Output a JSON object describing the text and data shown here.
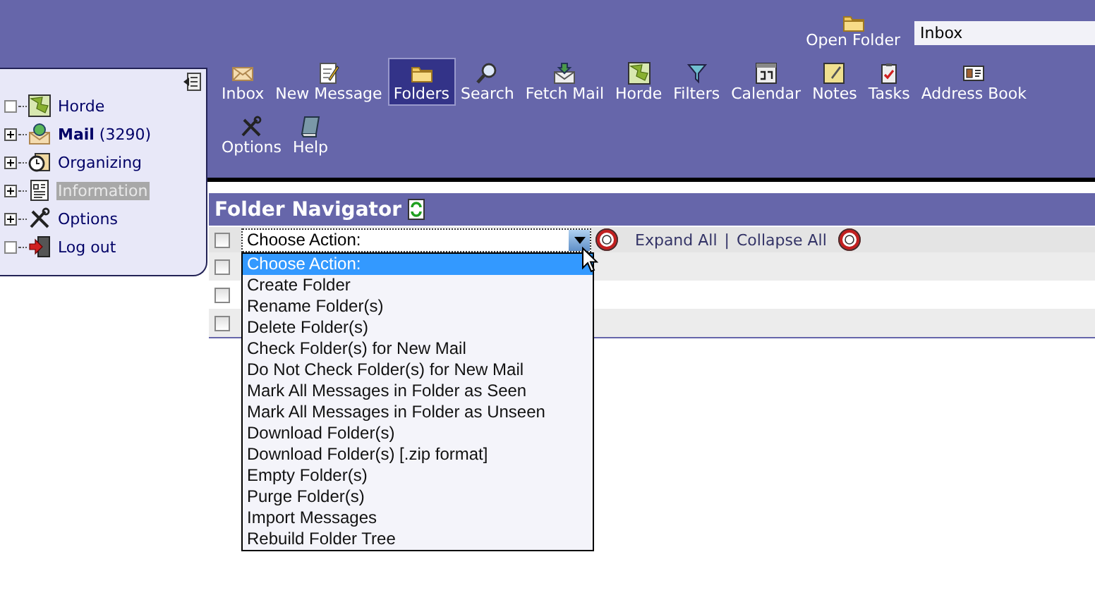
{
  "open_folder": {
    "label": "Open Folder",
    "value": "Inbox"
  },
  "toolbar": {
    "rows": [
      [
        {
          "label": "Inbox",
          "selected": false
        },
        {
          "label": "New Message",
          "selected": false
        },
        {
          "label": "Folders",
          "selected": true
        },
        {
          "label": "Search",
          "selected": false
        },
        {
          "label": "Fetch Mail",
          "selected": false
        },
        {
          "label": "Horde",
          "selected": false
        },
        {
          "label": "Filters",
          "selected": false
        },
        {
          "label": "Calendar",
          "selected": false
        },
        {
          "label": "Notes",
          "selected": false
        },
        {
          "label": "Tasks",
          "selected": false
        },
        {
          "label": "Address Book",
          "selected": false
        }
      ],
      [
        {
          "label": "Options",
          "selected": false
        },
        {
          "label": "Help",
          "selected": false
        }
      ]
    ]
  },
  "sidebar": {
    "items": [
      {
        "label": "Horde",
        "expandable": false,
        "selected": false
      },
      {
        "label": "**Mail** (3290)",
        "expandable": true,
        "selected": false
      },
      {
        "label": "Organizing",
        "expandable": true,
        "selected": false
      },
      {
        "label": "Information",
        "expandable": true,
        "selected": true
      },
      {
        "label": "Options",
        "expandable": true,
        "selected": false
      },
      {
        "label": "Log out",
        "expandable": false,
        "selected": false
      }
    ]
  },
  "folder_navigator": {
    "title": "Folder Navigator",
    "select_all": {
      "checked": false
    },
    "action_select": {
      "value": "Choose Action:",
      "expanded": true,
      "options": [
        {
          "label": "Choose Action:",
          "selected": true
        },
        {
          "label": "Create Folder",
          "selected": false
        },
        {
          "label": "Rename Folder(s)",
          "selected": false
        },
        {
          "label": "Delete Folder(s)",
          "selected": false
        },
        {
          "label": "Check Folder(s) for New Mail",
          "selected": false
        },
        {
          "label": "Do Not Check Folder(s) for New Mail",
          "selected": false
        },
        {
          "label": "Mark All Messages in Folder as Seen",
          "selected": false
        },
        {
          "label": "Mark All Messages in Folder as Unseen",
          "selected": false
        },
        {
          "label": "Download Folder(s)",
          "selected": false
        },
        {
          "label": "Download Folder(s) [.zip format]",
          "selected": false
        },
        {
          "label": "Empty Folder(s)",
          "selected": false
        },
        {
          "label": "Purge Folder(s)",
          "selected": false
        },
        {
          "label": "Import Messages",
          "selected": false
        },
        {
          "label": "Rebuild Folder Tree",
          "selected": false
        }
      ]
    },
    "links": [
      "Expand All",
      "Collapse All"
    ],
    "separator": "|",
    "rows": [
      {
        "checked": false
      },
      {
        "checked": false
      },
      {
        "checked": false
      }
    ]
  }
}
